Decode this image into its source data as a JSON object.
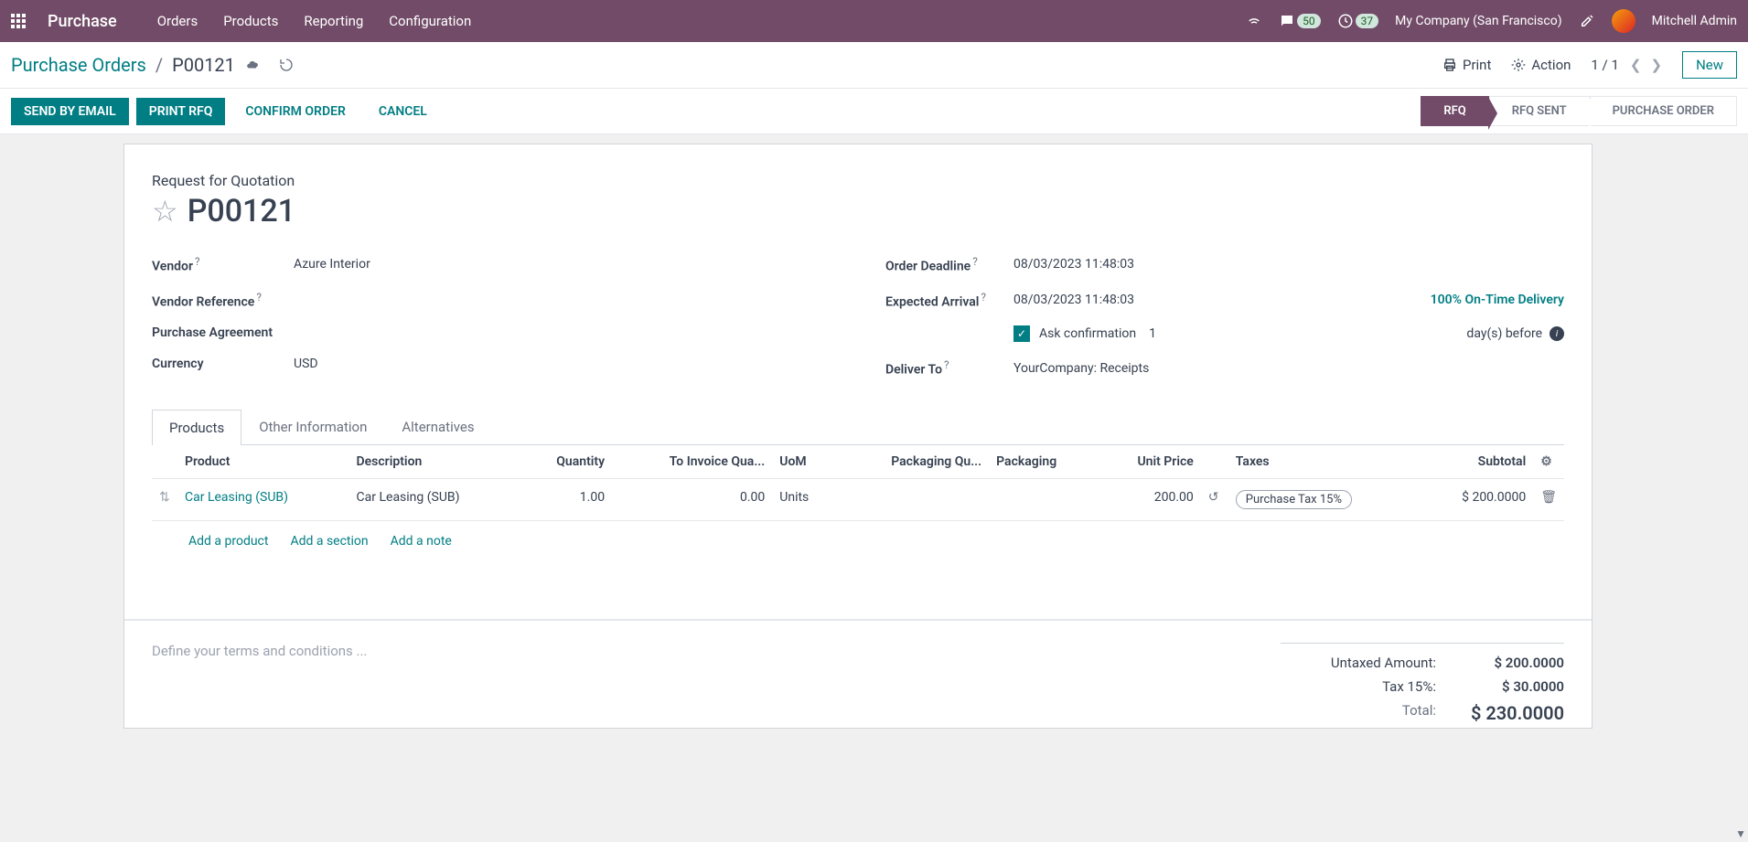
{
  "topbar": {
    "brand": "Purchase",
    "nav": [
      "Orders",
      "Products",
      "Reporting",
      "Configuration"
    ],
    "msg_badge": "50",
    "clock_badge": "37",
    "company": "My Company (San Francisco)",
    "user": "Mitchell Admin"
  },
  "control": {
    "breadcrumb_root": "Purchase Orders",
    "breadcrumb_current": "P00121",
    "print": "Print",
    "action": "Action",
    "pager": "1 / 1",
    "new": "New"
  },
  "status": {
    "send_email": "SEND BY EMAIL",
    "print_rfq": "PRINT RFQ",
    "confirm": "CONFIRM ORDER",
    "cancel": "CANCEL",
    "steps": [
      "RFQ",
      "RFQ SENT",
      "PURCHASE ORDER"
    ]
  },
  "doc": {
    "rfq_label": "Request for Quotation",
    "name": "P00121",
    "fields_left": {
      "vendor_label": "Vendor",
      "vendor": "Azure Interior",
      "vendor_ref_label": "Vendor Reference",
      "vendor_ref": "",
      "agreement_label": "Purchase Agreement",
      "agreement": "",
      "currency_label": "Currency",
      "currency": "USD"
    },
    "fields_right": {
      "deadline_label": "Order Deadline",
      "deadline": "08/03/2023 11:48:03",
      "arrival_label": "Expected Arrival",
      "arrival": "08/03/2023 11:48:03",
      "ontime": "100% On-Time Delivery",
      "ask_confirm": "Ask confirmation",
      "ask_days": "1",
      "days_before": "day(s) before",
      "deliver_label": "Deliver To",
      "deliver": "YourCompany: Receipts"
    },
    "tabs": [
      "Products",
      "Other Information",
      "Alternatives"
    ],
    "columns": {
      "product": "Product",
      "description": "Description",
      "quantity": "Quantity",
      "to_invoice": "To Invoice Qua...",
      "uom": "UoM",
      "pkg_qty": "Packaging Qu...",
      "packaging": "Packaging",
      "unit_price": "Unit Price",
      "taxes": "Taxes",
      "subtotal": "Subtotal"
    },
    "line": {
      "product": "Car Leasing (SUB)",
      "description": "Car Leasing (SUB)",
      "quantity": "1.00",
      "to_invoice": "0.00",
      "uom": "Units",
      "pkg_qty": "",
      "packaging": "",
      "unit_price": "200.00",
      "tax": "Purchase Tax 15%",
      "subtotal": "$ 200.0000"
    },
    "add": {
      "product": "Add a product",
      "section": "Add a section",
      "note": "Add a note"
    },
    "terms_placeholder": "Define your terms and conditions ...",
    "totals": {
      "untaxed_label": "Untaxed Amount:",
      "untaxed": "$ 200.0000",
      "tax_label": "Tax 15%:",
      "tax": "$ 30.0000",
      "total_label": "Total:",
      "total": "$ 230.0000"
    }
  }
}
